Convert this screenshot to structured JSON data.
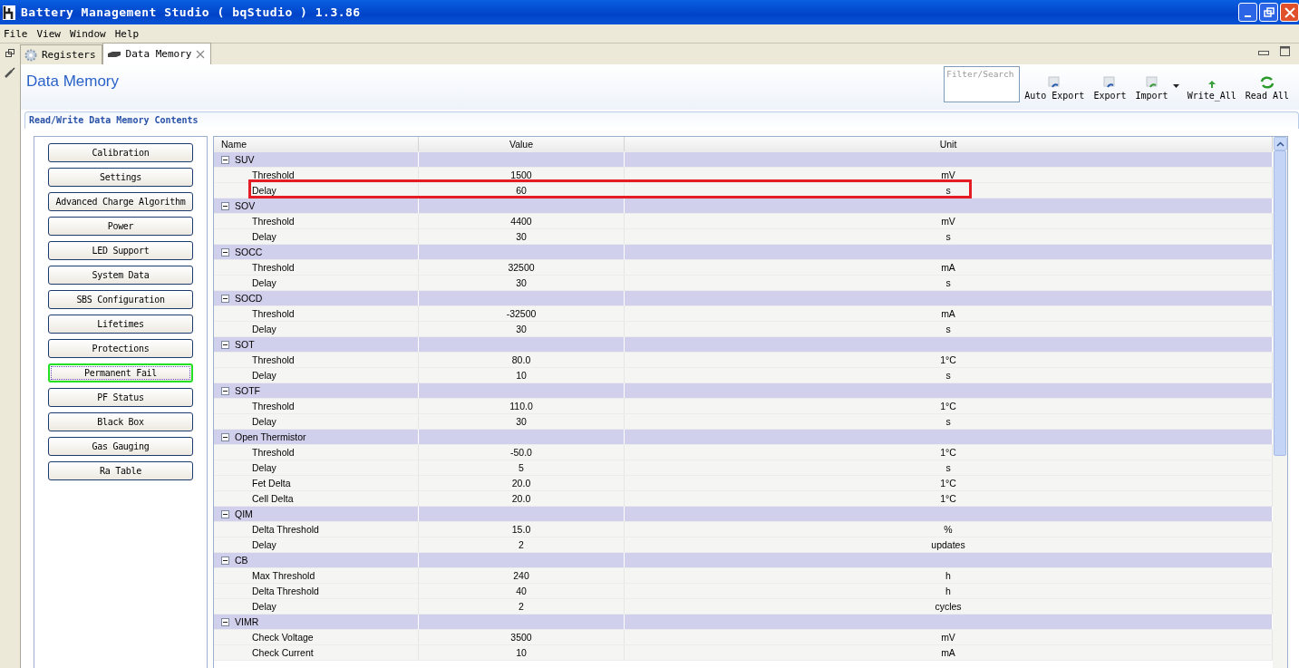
{
  "window": {
    "title": "Battery Management Studio ( bqStudio ) 1.3.86"
  },
  "menu": [
    "File",
    "View",
    "Window",
    "Help"
  ],
  "tabs": [
    {
      "label": "Registers",
      "selected": false
    },
    {
      "label": "Data Memory",
      "selected": true
    }
  ],
  "header": {
    "title": "Data Memory",
    "search": {
      "placeholder": "Filter/Search"
    },
    "actions": [
      {
        "label": "Auto Export",
        "kind": "export"
      },
      {
        "label": "Export",
        "kind": "export"
      },
      {
        "label": "Import",
        "kind": "import"
      },
      {
        "label": "Write_All",
        "kind": "write"
      },
      {
        "label": "Read All",
        "kind": "read"
      }
    ]
  },
  "section_title": "Read/Write Data Memory Contents",
  "categories": [
    {
      "label": "Calibration",
      "selected": false
    },
    {
      "label": "Settings",
      "selected": false
    },
    {
      "label": "Advanced Charge Algorithm",
      "selected": false
    },
    {
      "label": "Power",
      "selected": false
    },
    {
      "label": "LED Support",
      "selected": false
    },
    {
      "label": "System Data",
      "selected": false
    },
    {
      "label": "SBS Configuration",
      "selected": false
    },
    {
      "label": "Lifetimes",
      "selected": false
    },
    {
      "label": "Protections",
      "selected": false
    },
    {
      "label": "Permanent Fail",
      "selected": true
    },
    {
      "label": "PF Status",
      "selected": false
    },
    {
      "label": "Black Box",
      "selected": false
    },
    {
      "label": "Gas Gauging",
      "selected": false
    },
    {
      "label": "Ra Table",
      "selected": false
    }
  ],
  "table": {
    "columns": [
      "Name",
      "Value",
      "Unit"
    ],
    "groups": [
      {
        "name": "SUV",
        "expanded": true,
        "children": [
          {
            "name": "Threshold",
            "value": "1500",
            "unit": "mV",
            "highlighted": false
          },
          {
            "name": "Delay",
            "value": "60",
            "unit": "s",
            "highlighted": true
          }
        ]
      },
      {
        "name": "SOV",
        "expanded": true,
        "children": [
          {
            "name": "Threshold",
            "value": "4400",
            "unit": "mV",
            "highlighted": false
          },
          {
            "name": "Delay",
            "value": "30",
            "unit": "s",
            "highlighted": false
          }
        ]
      },
      {
        "name": "SOCC",
        "expanded": true,
        "children": [
          {
            "name": "Threshold",
            "value": "32500",
            "unit": "mA",
            "highlighted": false
          },
          {
            "name": "Delay",
            "value": "30",
            "unit": "s",
            "highlighted": false
          }
        ]
      },
      {
        "name": "SOCD",
        "expanded": true,
        "children": [
          {
            "name": "Threshold",
            "value": "-32500",
            "unit": "mA",
            "highlighted": false
          },
          {
            "name": "Delay",
            "value": "30",
            "unit": "s",
            "highlighted": false
          }
        ]
      },
      {
        "name": "SOT",
        "expanded": true,
        "children": [
          {
            "name": "Threshold",
            "value": "80.0",
            "unit": "1°C",
            "highlighted": false
          },
          {
            "name": "Delay",
            "value": "10",
            "unit": "s",
            "highlighted": false
          }
        ]
      },
      {
        "name": "SOTF",
        "expanded": true,
        "children": [
          {
            "name": "Threshold",
            "value": "110.0",
            "unit": "1°C",
            "highlighted": false
          },
          {
            "name": "Delay",
            "value": "30",
            "unit": "s",
            "highlighted": false
          }
        ]
      },
      {
        "name": "Open Thermistor",
        "expanded": true,
        "children": [
          {
            "name": "Threshold",
            "value": "-50.0",
            "unit": "1°C",
            "highlighted": false
          },
          {
            "name": "Delay",
            "value": "5",
            "unit": "s",
            "highlighted": false
          },
          {
            "name": "Fet Delta",
            "value": "20.0",
            "unit": "1°C",
            "highlighted": false
          },
          {
            "name": "Cell Delta",
            "value": "20.0",
            "unit": "1°C",
            "highlighted": false
          }
        ]
      },
      {
        "name": "QIM",
        "expanded": true,
        "children": [
          {
            "name": "Delta Threshold",
            "value": "15.0",
            "unit": "%",
            "highlighted": false
          },
          {
            "name": "Delay",
            "value": "2",
            "unit": "updates",
            "highlighted": false
          }
        ]
      },
      {
        "name": "CB",
        "expanded": true,
        "children": [
          {
            "name": "Max Threshold",
            "value": "240",
            "unit": "h",
            "highlighted": false
          },
          {
            "name": "Delta Threshold",
            "value": "40",
            "unit": "h",
            "highlighted": false
          },
          {
            "name": "Delay",
            "value": "2",
            "unit": "cycles",
            "highlighted": false
          }
        ]
      },
      {
        "name": "VIMR",
        "expanded": true,
        "children": [
          {
            "name": "Check Voltage",
            "value": "3500",
            "unit": "mV",
            "highlighted": false
          },
          {
            "name": "Check Current",
            "value": "10",
            "unit": "mA",
            "highlighted": false
          }
        ]
      }
    ]
  }
}
